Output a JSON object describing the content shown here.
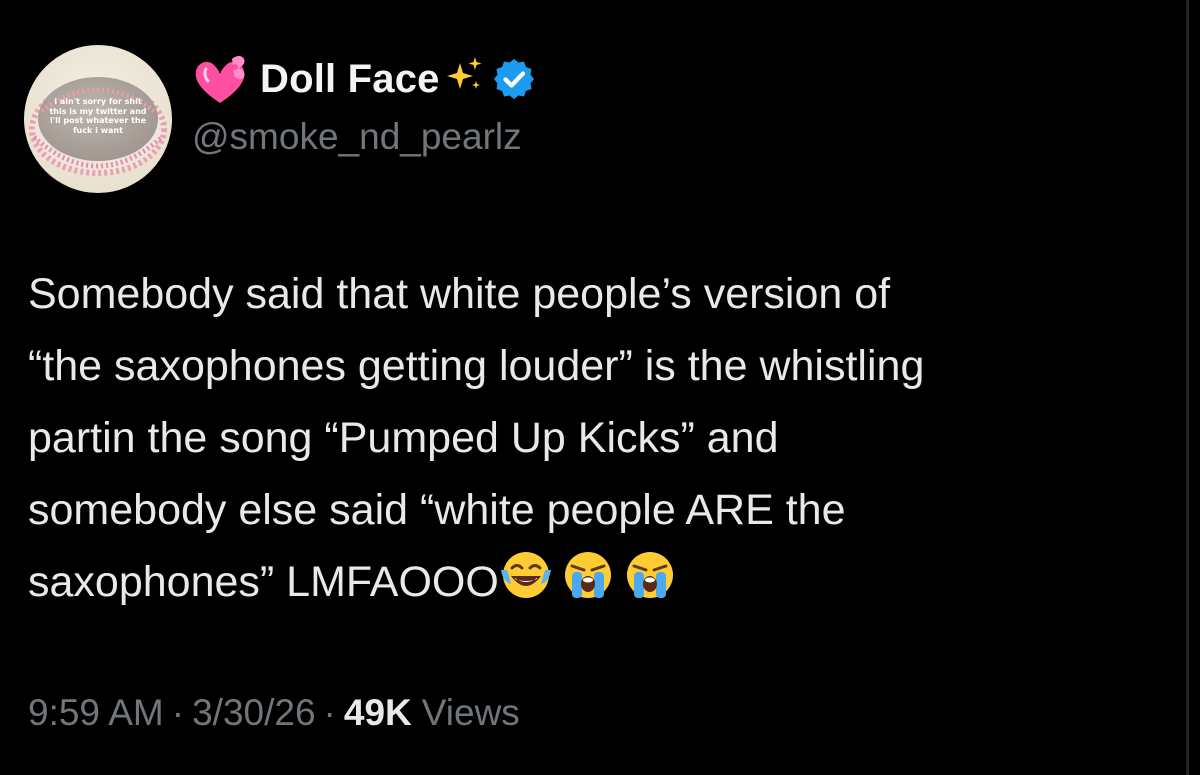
{
  "author": {
    "display_name": "Doll Face",
    "handle": "@smoke_nd_pearlz",
    "verified": true,
    "name_emoji_before": "heart-with-ribbon",
    "name_emoji_after": "sparkles",
    "verified_badge_color": "#1d9bf0"
  },
  "avatar": {
    "image": "cake with pink piped trim and icing text",
    "cake_text": [
      "i ain't sorry for shit",
      "this is my twitter and",
      "i'll post whatever the",
      "fuck i want"
    ]
  },
  "tweet": {
    "lines": [
      "Somebody said that white people’s version of",
      "“the saxophones getting louder” is the whistling",
      "partin the song “Pumped Up Kicks” and",
      "somebody else said “white people ARE the",
      "saxophones” LMFAOOO"
    ],
    "trailing_emojis": [
      "face-with-tears-of-joy",
      "loudly-crying-face",
      "loudly-crying-face"
    ]
  },
  "meta": {
    "time": "9:59 AM",
    "separator": "·",
    "date": "3/30/26",
    "views_count": "49K",
    "views_label": "Views"
  },
  "colors": {
    "background": "#000000",
    "text_primary": "#e7e9ea",
    "text_secondary": "#71767b",
    "accent": "#1d9bf0"
  }
}
